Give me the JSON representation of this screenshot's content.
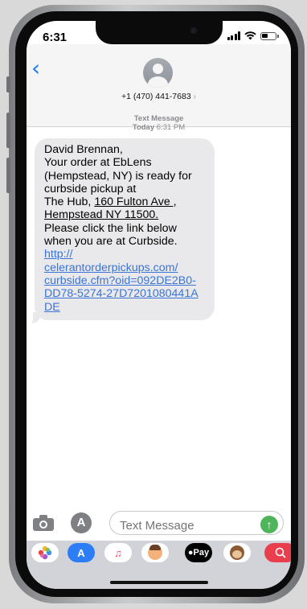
{
  "status_bar": {
    "time": "6:31"
  },
  "header": {
    "back_icon": "chevron-left-icon",
    "contact_number": "+1 (470) 441-7683",
    "contact_chevron": "›"
  },
  "conversation": {
    "service_label": "Text Message",
    "date_label": "Today",
    "time_label": "6:31 PM"
  },
  "message": {
    "lines": [
      "David Brennan,",
      "Your order at EbLens",
      "(Hempstead, NY) is ready for",
      "curbside pickup at",
      "The Hub,",
      "160 Fulton Ave ,",
      "Hempstead NY 11500.",
      "Please click the link below",
      "when you are at Curbside."
    ],
    "link_lines": [
      "http://",
      "celerantorderpickups.com/",
      "curbside.cfm?oid=092DE2B0-",
      "DD78-5274-27D7201080441A",
      "DE"
    ]
  },
  "composer": {
    "placeholder": "Text Message",
    "camera_icon": "camera-icon",
    "appstore_icon": "app-store-icon",
    "send_icon": "arrow-up-icon"
  },
  "app_drawer": {
    "apps": [
      {
        "name": "photos-icon",
        "label": ""
      },
      {
        "name": "app-store-icon",
        "label": "A"
      },
      {
        "name": "music-icon",
        "label": "♫"
      },
      {
        "name": "memoji-icon",
        "label": ""
      },
      {
        "name": "apple-pay-icon",
        "label": "Pay"
      },
      {
        "name": "monkey-animoji-icon",
        "label": ""
      },
      {
        "name": "web-search-icon",
        "label": ""
      }
    ]
  }
}
